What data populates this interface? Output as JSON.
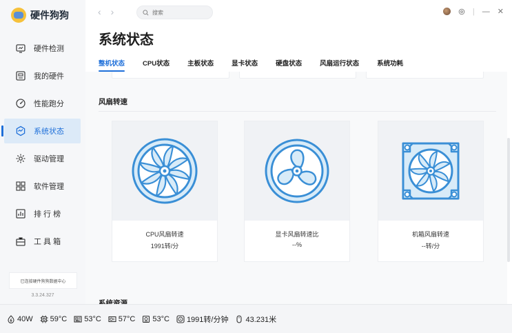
{
  "app": {
    "name": "硬件狗狗"
  },
  "sidebar": {
    "items": [
      {
        "label": "硬件检测",
        "icon": "monitor-icon"
      },
      {
        "label": "我的硬件",
        "icon": "hardware-icon"
      },
      {
        "label": "性能跑分",
        "icon": "gauge-icon"
      },
      {
        "label": "系统状态",
        "icon": "system-status-icon",
        "active": true
      },
      {
        "label": "驱动管理",
        "icon": "gear-icon"
      },
      {
        "label": "软件管理",
        "icon": "apps-icon"
      },
      {
        "label": "排 行 榜",
        "icon": "ranking-icon"
      },
      {
        "label": "工 具 箱",
        "icon": "toolbox-icon"
      }
    ],
    "connection_status": "已连接硬件狗狗数据中心",
    "version": "3.3.24.327"
  },
  "topbar": {
    "search_placeholder": "搜索"
  },
  "page": {
    "title": "系统状态",
    "tabs": [
      "整机状态",
      "CPU状态",
      "主板状态",
      "显卡状态",
      "硬盘状态",
      "风扇运行状态",
      "系统功耗"
    ],
    "active_tab": "整机状态"
  },
  "fan_section": {
    "title": "风扇转速",
    "cards": [
      {
        "label": "CPU风扇转速",
        "value": "1991转/分"
      },
      {
        "label": "显卡风扇转速比",
        "value": "--%"
      },
      {
        "label": "机箱风扇转速",
        "value": "--转/分"
      }
    ]
  },
  "resource_section": {
    "title": "系统资源"
  },
  "statusbar": {
    "power": "40W",
    "cpu_temp": "59°C",
    "board_temp": "53°C",
    "gpu_temp": "57°C",
    "disk_temp": "53°C",
    "fan_speed": "1991转/分钟",
    "mouse_distance": "43.231米"
  },
  "colors": {
    "accent": "#1e6fd9",
    "fan_blue": "#3a8fd6",
    "fan_fill": "#d8ebf8"
  }
}
